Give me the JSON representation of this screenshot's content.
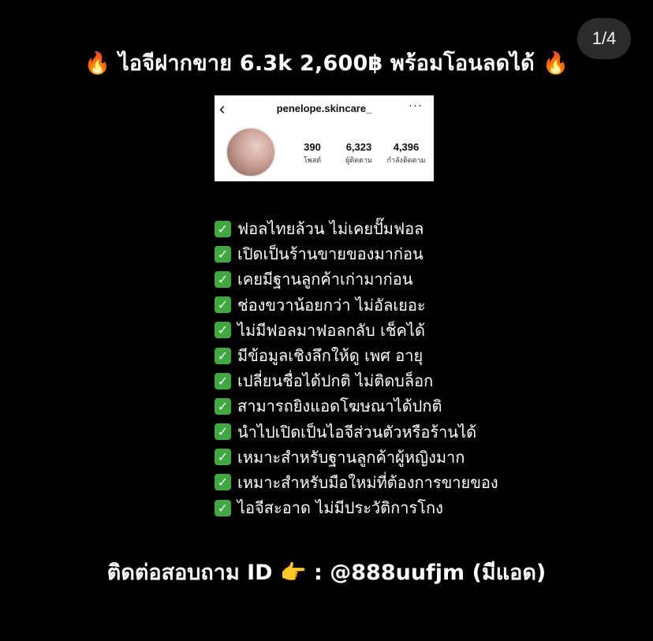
{
  "counter": "1/4",
  "title": {
    "text": "ไอจีฝากขาย 6.3k 2,600฿ พร้อมโอนลดได้"
  },
  "profile_card": {
    "back_icon": "‹",
    "username": "penelope.skincare_",
    "more_icon": "···",
    "stats": [
      {
        "value": "390",
        "label": "โพสต์"
      },
      {
        "value": "6,323",
        "label": "ผู้ติดตาม"
      },
      {
        "value": "4,396",
        "label": "กำลังติดตาม"
      }
    ]
  },
  "checklist": [
    "ฟอลไทยล้วน ไม่เคยปั๊มฟอล",
    "เปิดเป็นร้านขายของมาก่อน",
    "เคยมีฐานลูกค้าเก่ามาก่อน",
    "ช่องขวาน้อยกว่า ไม่อัลเยอะ",
    "ไม่มีฟอลมาฟอลกลับ เช็คได้",
    "มีข้อมูลเชิงลึกให้ดู เพศ อายุ",
    "เปลี่ยนชื่อได้ปกติ ไม่ติดบล็อก",
    "สามารถยิงแอดโฆษณาได้ปกติ",
    "นำไปเปิดเป็นไอจีส่วนตัวหรือร้านได้",
    "เหมาะสำหรับฐานลูกค้าผู้หญิงมาก",
    "เหมาะสำหรับมือใหม่ที่ต้องการขายของ",
    "ไอจีสะอาด ไม่มีประวัติการโกง"
  ],
  "contact": {
    "prefix": "ติดต่อสอบถาม ID",
    "suffix": ": @888uufjm (มีแอด)"
  },
  "icons": {
    "flame": "flame-icon",
    "check": "check-icon",
    "pointer": "pointing-hand-icon"
  },
  "colors": {
    "background": "#000000",
    "check": "#3fa83f",
    "text": "#ffffff"
  }
}
